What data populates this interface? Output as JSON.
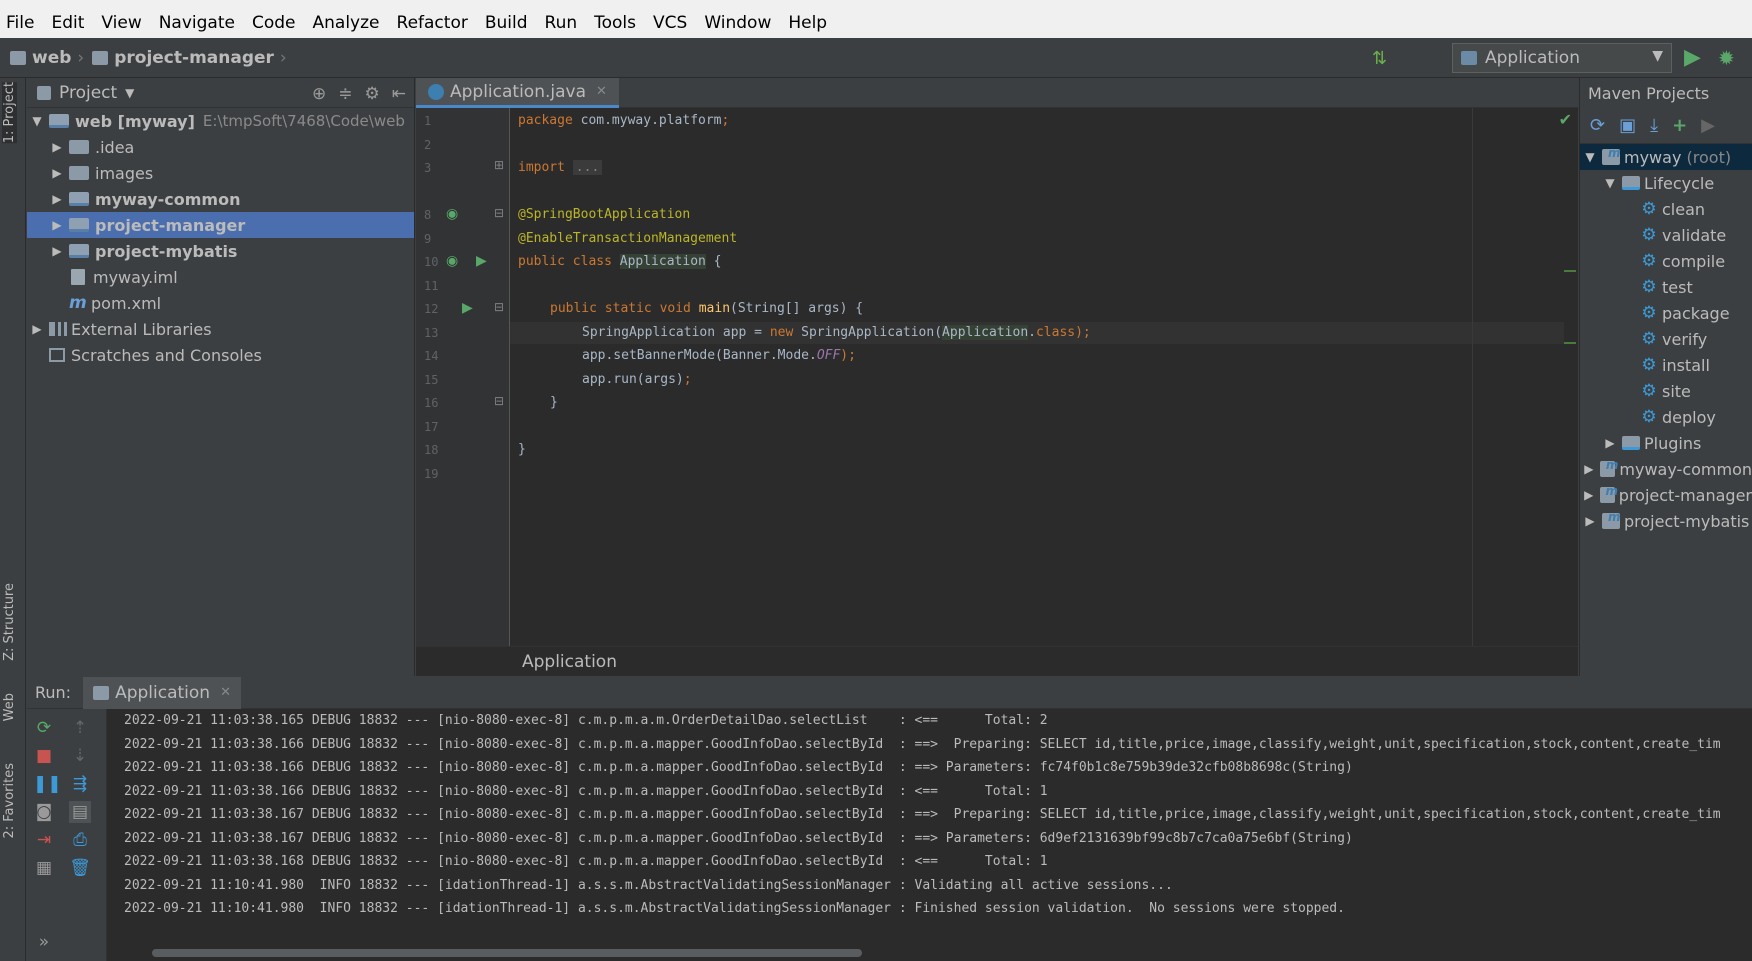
{
  "menu": [
    "File",
    "Edit",
    "View",
    "Navigate",
    "Code",
    "Analyze",
    "Refactor",
    "Build",
    "Run",
    "Tools",
    "VCS",
    "Window",
    "Help"
  ],
  "breadcrumb": [
    {
      "label": "web"
    },
    {
      "label": "project-manager"
    }
  ],
  "run_config": {
    "label": "Application"
  },
  "left_strip": {
    "project_tab": "1: Project",
    "structure_tab": "Z: Structure",
    "web_tab": "Web",
    "favorites_tab": "2: Favorites"
  },
  "project": {
    "title": "Project",
    "items": [
      {
        "label": "web [myway]",
        "path": "E:\\tmpSoft\\7468\\Code\\web"
      },
      {
        "label": ".idea"
      },
      {
        "label": "images"
      },
      {
        "label": "myway-common"
      },
      {
        "label": "project-manager"
      },
      {
        "label": "project-mybatis"
      },
      {
        "label": "myway.iml"
      },
      {
        "label": "pom.xml"
      },
      {
        "label": "External Libraries"
      },
      {
        "label": "Scratches and Consoles"
      }
    ]
  },
  "editor": {
    "tab": "Application.java",
    "line_numbers": [
      "1",
      "2",
      "3",
      "8",
      "9",
      "10",
      "11",
      "12",
      "13",
      "14",
      "15",
      "16",
      "17",
      "18",
      "19"
    ],
    "breadcrumb": "Application",
    "code": {
      "l1_kw": "package",
      "l1_rest": " com.myway.platform",
      "semi": ";",
      "l3_kw": "import",
      "l3_fold": "...",
      "l8": "@SpringBootApplication",
      "l9": "@EnableTransactionManagement",
      "l10_kw": "public class",
      "l10_cls": "Application",
      "l10_rest": " {",
      "l12_kw": "public static void",
      "l12_fn": "main",
      "l12_rest": "(String[] args) {",
      "l13_a": "SpringApplication app = ",
      "l13_new": "new",
      "l13_b": " SpringApplication(",
      "l13_cls": "Application",
      "l13_dot": ".",
      "l13_kw": "class",
      "l13_end": ");",
      "l14_a": "app.setBannerMode(Banner.Mode.",
      "l14_it": "OFF",
      "l14_end": ");",
      "l15": "app.run(args)",
      "brace_close": "}"
    }
  },
  "maven": {
    "title": "Maven Projects",
    "root": "myway",
    "root_suffix": "(root)",
    "lifecycle": "Lifecycle",
    "goals": [
      "clean",
      "validate",
      "compile",
      "test",
      "package",
      "verify",
      "install",
      "site",
      "deploy"
    ],
    "plugins": "Plugins",
    "modules": [
      "myway-common",
      "project-manager",
      "project-mybatis"
    ]
  },
  "run": {
    "label": "Run:",
    "tab": "Application",
    "lines": [
      "2022-09-21 11:03:38.165 DEBUG 18832 --- [nio-8080-exec-8] c.m.p.m.a.m.OrderDetailDao.selectList    : <==      Total: 2",
      "2022-09-21 11:03:38.166 DEBUG 18832 --- [nio-8080-exec-8] c.m.p.m.a.mapper.GoodInfoDao.selectById  : ==>  Preparing: SELECT id,title,price,image,classify,weight,unit,specification,stock,content,create_tim",
      "2022-09-21 11:03:38.166 DEBUG 18832 --- [nio-8080-exec-8] c.m.p.m.a.mapper.GoodInfoDao.selectById  : ==> Parameters: fc74f0b1c8e759b39de32cfb08b8698c(String)",
      "2022-09-21 11:03:38.166 DEBUG 18832 --- [nio-8080-exec-8] c.m.p.m.a.mapper.GoodInfoDao.selectById  : <==      Total: 1",
      "2022-09-21 11:03:38.167 DEBUG 18832 --- [nio-8080-exec-8] c.m.p.m.a.mapper.GoodInfoDao.selectById  : ==>  Preparing: SELECT id,title,price,image,classify,weight,unit,specification,stock,content,create_tim",
      "2022-09-21 11:03:38.167 DEBUG 18832 --- [nio-8080-exec-8] c.m.p.m.a.mapper.GoodInfoDao.selectById  : ==> Parameters: 6d9ef2131639bf99c8b7c7ca0a75e6bf(String)",
      "2022-09-21 11:03:38.168 DEBUG 18832 --- [nio-8080-exec-8] c.m.p.m.a.mapper.GoodInfoDao.selectById  : <==      Total: 1",
      "2022-09-21 11:10:41.980  INFO 18832 --- [idationThread-1] a.s.s.m.AbstractValidatingSessionManager : Validating all active sessions...",
      "2022-09-21 11:10:41.980  INFO 18832 --- [idationThread-1] a.s.s.m.AbstractValidatingSessionManager : Finished session validation.  No sessions were stopped."
    ]
  }
}
